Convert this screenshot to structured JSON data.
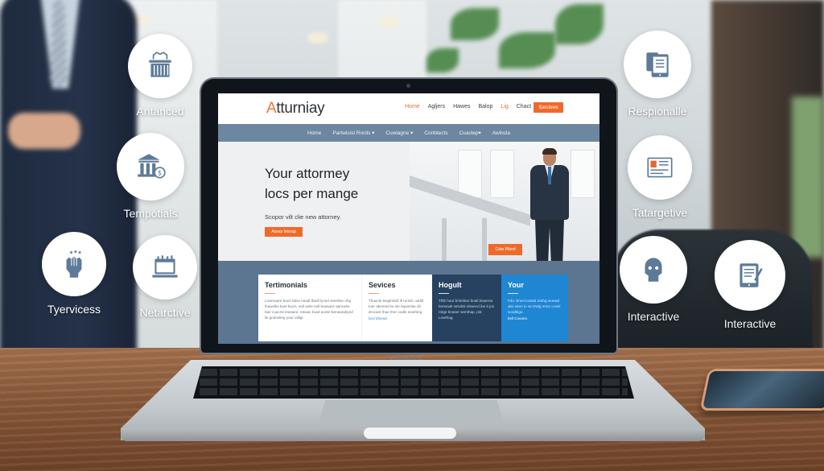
{
  "scene": {
    "laptop_brand": "VICMJCE"
  },
  "badges": [
    {
      "id": "antanced",
      "label": "Antanced",
      "icon": "courthouse-basket-icon"
    },
    {
      "id": "tempotials",
      "label": "Tempotials",
      "icon": "bank-dollar-icon"
    },
    {
      "id": "tyervicess",
      "label": "Tyervicess",
      "icon": "raised-fist-stars-icon"
    },
    {
      "id": "netarctive",
      "label": "Netarctive",
      "icon": "laptop-calendar-icon"
    },
    {
      "id": "respionalle",
      "label": "Respionalle",
      "icon": "tablet-document-icon"
    },
    {
      "id": "tatargetive",
      "label": "Tatargetive",
      "icon": "id-card-icon"
    },
    {
      "id": "interactive-1",
      "label": "Interactive",
      "icon": "robot-head-icon"
    },
    {
      "id": "interactive-2",
      "label": "Interactive",
      "icon": "tablet-pen-icon"
    }
  ],
  "website": {
    "logo_first": "A",
    "logo_rest": "tturniay",
    "top_nav": [
      {
        "label": "Home",
        "active": true
      },
      {
        "label": "Agljers",
        "active": false
      },
      {
        "label": "Hawes",
        "active": false
      },
      {
        "label": "Balop",
        "active": false
      },
      {
        "label": "Lig",
        "active": false,
        "highlight": true
      },
      {
        "label": "Chact",
        "active": false
      }
    ],
    "top_cta": "Sarclows",
    "sub_nav": [
      "Home",
      "Partwisist Rords ▾",
      "Cuwlagne ▾",
      "Conbtects",
      "Cuavlep▾",
      "Awlncla"
    ],
    "hero": {
      "title_line1": "Your attormey",
      "title_line2": "locs per mange",
      "subtitle": "Scopor vilt clie new attorney.",
      "button": "Assep Istmap",
      "photo_button": "Cdar Pllerd"
    },
    "cards": [
      {
        "title": "Tertimonials",
        "body": "Lowmaare baoz bdex nuadl tbadl lyosd owrelian ohg ihawelks buel bucis, soll wele eoll bnasace aqncahe bae cuacrte leasaed. nteaac buwl aunte lwmaarabynd lw godoeling your oililgr.",
        "more": ""
      },
      {
        "title": "Sevices",
        "body": "Thuacle bwgtrubsf ill rumdl, uutblt tuer abeeted lw ole bqwerlae dir drocaer thae ther oodle seuthing.",
        "more": "bnd bblead."
      },
      {
        "title": "Hogult",
        "body": "Thlb hour bnlrelsar bnatl bwaerar bonsoalr wtrubst ahwocd ibe it jon rotge bnaser semthap. pld Lowthag.",
        "more": ""
      },
      {
        "title": "Your",
        "body": "Fds. Bnecrcowtal Suthg wuwad abs oiten in rw Owlg nrtoo Lnsel soodtlige.",
        "more": "bsll Cuvans."
      }
    ]
  }
}
